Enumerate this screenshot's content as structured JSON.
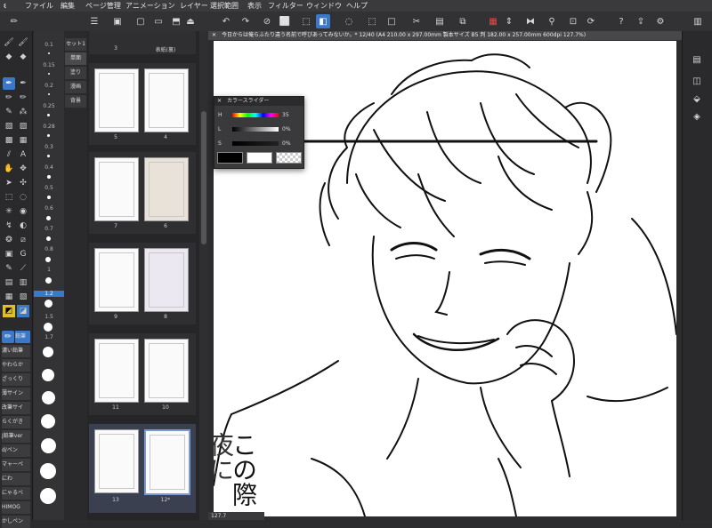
{
  "menubar": {
    "items": [
      "ファイル",
      "編集",
      "ページ管理",
      "アニメーション",
      "レイヤー",
      "選択範囲",
      "表示",
      "フィルター",
      "ウィンドウ",
      "ヘルプ"
    ]
  },
  "brush_sizes": [
    "0.1",
    "0.15",
    "0.2",
    "0.25",
    "0.28",
    "0.3",
    "0.4",
    "0.5",
    "0.6",
    "0.7",
    "0.8",
    "1",
    "1.2",
    "1.5",
    "1.7"
  ],
  "tool_subitems": [
    "鉛筆",
    "濃い鉛筆",
    "やわらか",
    "ざっくり",
    "薄サイン",
    "改筆サイ",
    "らくがき",
    "J鉛筆ver",
    "d/ペン",
    "マャーペ",
    "にわ",
    "にゃるべ",
    "HIMOG",
    "かしペン"
  ],
  "layer_tabs": [
    "セット1",
    "単面",
    "塗り",
    "漫画",
    "背景"
  ],
  "pages": {
    "spreads": [
      {
        "left": "3",
        "right": "表紙(裏)"
      },
      {
        "left": "5",
        "right": "4"
      },
      {
        "left": "7",
        "right": "6"
      },
      {
        "left": "9",
        "right": "8"
      },
      {
        "left": "11",
        "right": "10"
      },
      {
        "left": "13",
        "right": "12*"
      }
    ]
  },
  "document": {
    "tab_title": "今日からは俺らふたり違う名前で呼びあってみないか。* 12/40 (A4 210.00 x 297.00mm 製本サイズ B5 判 182.00 x 257.00mm 600dpi 127.7%)"
  },
  "color_slider": {
    "title": "カラースライダー",
    "rows": [
      {
        "label": "H",
        "value": "35"
      },
      {
        "label": "L",
        "value": "0%"
      },
      {
        "label": "S",
        "value": "0%"
      }
    ],
    "main_color": "#000000",
    "sub_color": "#ffffff"
  },
  "canvas_text": {
    "col1": "この際",
    "col2": "夜に"
  },
  "status": {
    "zoom": "127.7"
  }
}
